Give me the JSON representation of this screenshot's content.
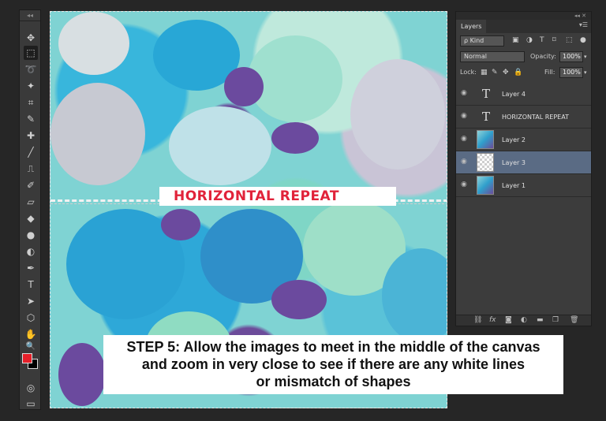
{
  "toolbar": {
    "grip": "◂◂",
    "tools": [
      "move-tool",
      "marquee-tool",
      "lasso-tool",
      "magic-wand-tool",
      "crop-tool",
      "eyedropper-tool",
      "healing-brush-tool",
      "brush-tool",
      "clone-stamp-tool",
      "history-brush-tool",
      "eraser-tool",
      "paint-bucket-tool",
      "blur-tool",
      "dodge-tool",
      "pen-tool",
      "type-tool",
      "path-selection-tool",
      "shape-tool",
      "hand-tool",
      "zoom-tool"
    ],
    "glyphs": [
      "✥",
      "⬚",
      "➰",
      "✦",
      "⌗",
      "✎",
      "✚",
      "╱",
      "⎍",
      "✐",
      "▱",
      "◆",
      "●",
      "◐",
      "✒",
      "T",
      "➤",
      "⬡",
      "✋",
      "🔍"
    ],
    "foreground_color": "#e6202a",
    "background_color": "#000000"
  },
  "canvas": {
    "label": "HORIZONTAL REPEAT"
  },
  "caption": {
    "line1": "STEP 5: Allow the images to meet in the middle of the canvas",
    "line2": "and zoom in very  close to see if there are any white lines",
    "line3": "or mismatch of shapes"
  },
  "layers_panel": {
    "top_controls": "◂◂ ✕",
    "tab": "Layers",
    "tab_menu": "▾☰",
    "filter_kind": "ρ Kind",
    "blend_mode": "Normal",
    "opacity_label": "Opacity:",
    "opacity_value": "100%",
    "lock_label": "Lock:",
    "fill_label": "Fill:",
    "fill_value": "100%",
    "layers": [
      {
        "name": "Layer 4",
        "type": "text",
        "selected": false
      },
      {
        "name": "HORIZONTAL REPEAT",
        "type": "text",
        "selected": false
      },
      {
        "name": "Layer 2",
        "type": "image",
        "selected": false
      },
      {
        "name": "Layer 3",
        "type": "transparent",
        "selected": true
      },
      {
        "name": "Layer 1",
        "type": "image",
        "selected": false
      }
    ],
    "footer_icons": [
      "link-icon",
      "fx-icon",
      "mask-icon",
      "adjustment-icon",
      "folder-icon",
      "new-layer-icon",
      "trash-icon"
    ]
  }
}
